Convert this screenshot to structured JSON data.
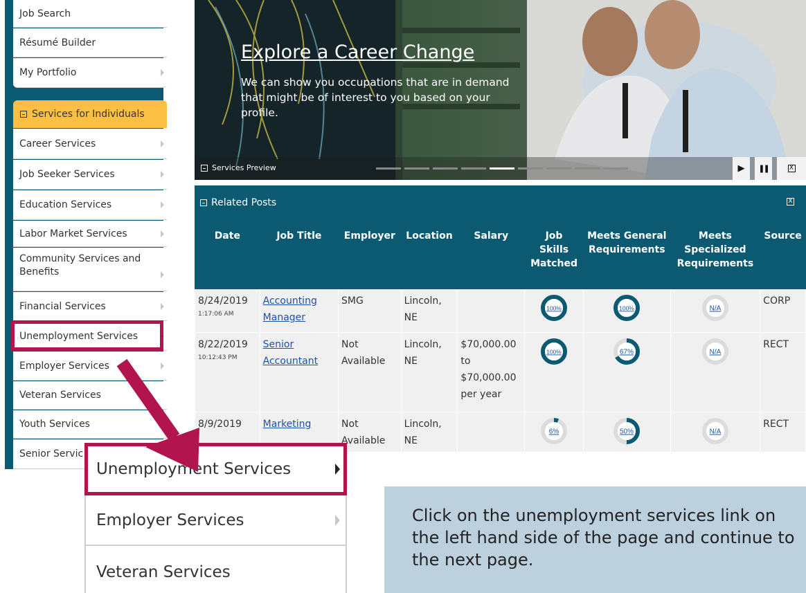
{
  "sidebar": {
    "top_items": [
      {
        "label": "Job Search",
        "arrow": false
      },
      {
        "label": "Résumé Builder",
        "arrow": false
      },
      {
        "label": "My Portfolio",
        "arrow": true
      }
    ],
    "section_header": "Services for Individuals",
    "items": [
      {
        "label": "Career Services"
      },
      {
        "label": "Job Seeker Services"
      },
      {
        "label": "Education Services"
      },
      {
        "label": "Labor Market Services"
      },
      {
        "label": "Community Services and Benefits"
      },
      {
        "label": "Financial Services"
      },
      {
        "label": "Unemployment Services"
      },
      {
        "label": "Employer Services"
      },
      {
        "label": "Veteran Services"
      },
      {
        "label": "Youth Services"
      },
      {
        "label": "Senior Servic"
      }
    ]
  },
  "hero": {
    "title": "Explore a Career Change",
    "description": "We can show you occupations that are in demand that might be of interest to you based on your profile.",
    "preview_label": "Services Preview",
    "slide_count": 9,
    "active_slide": 5,
    "controls": {
      "play": "▶",
      "pause": "❚❚",
      "close": "X"
    }
  },
  "related_posts": {
    "title": "Related Posts",
    "close": "X",
    "columns": [
      "Date",
      "Job Title",
      "Employer",
      "Location",
      "Salary",
      "Job Skills Matched",
      "Meets General Requirements",
      "Meets Specialized Requirements",
      "Source"
    ],
    "rows": [
      {
        "date": "8/24/2019",
        "time": "1:17:06 AM",
        "job_title": "Accounting Manager",
        "employer": "SMG",
        "location": "Lincoln, NE",
        "salary": "",
        "skills": {
          "label": "100%",
          "value": 1.0
        },
        "general": {
          "label": "100%",
          "value": 1.0
        },
        "specialized": {
          "label": "N/A",
          "value": 0
        },
        "source": "CORP"
      },
      {
        "date": "8/22/2019",
        "time": "10:12:43 PM",
        "job_title": "Senior Accountant",
        "employer": "Not Available",
        "location": "Lincoln, NE",
        "salary": "$70,000.00 to $70,000.00 per year",
        "skills": {
          "label": "100%",
          "value": 1.0
        },
        "general": {
          "label": "67%",
          "value": 0.67
        },
        "specialized": {
          "label": "N/A",
          "value": 0
        },
        "source": "RECT"
      },
      {
        "date": "8/9/2019",
        "time": "",
        "job_title": "Marketing",
        "employer": "Not Available",
        "location": "Lincoln, NE",
        "salary": "",
        "skills": {
          "label": "6%",
          "value": 0.06
        },
        "general": {
          "label": "50%",
          "value": 0.5
        },
        "specialized": {
          "label": "N/A",
          "value": 0
        },
        "source": "RECT"
      }
    ]
  },
  "zoom": {
    "items": [
      {
        "label": "Unemployment Services"
      },
      {
        "label": "Employer Services"
      },
      {
        "label": "Veteran Services"
      }
    ]
  },
  "callout": {
    "text": "Click on the unemployment services link on the left hand side of the page and continue to the next page."
  },
  "colors": {
    "brand_teal": "#0b5a72",
    "highlight": "#b2154d",
    "section_header": "#fbbf44",
    "callout_bg": "#bdd0de"
  }
}
